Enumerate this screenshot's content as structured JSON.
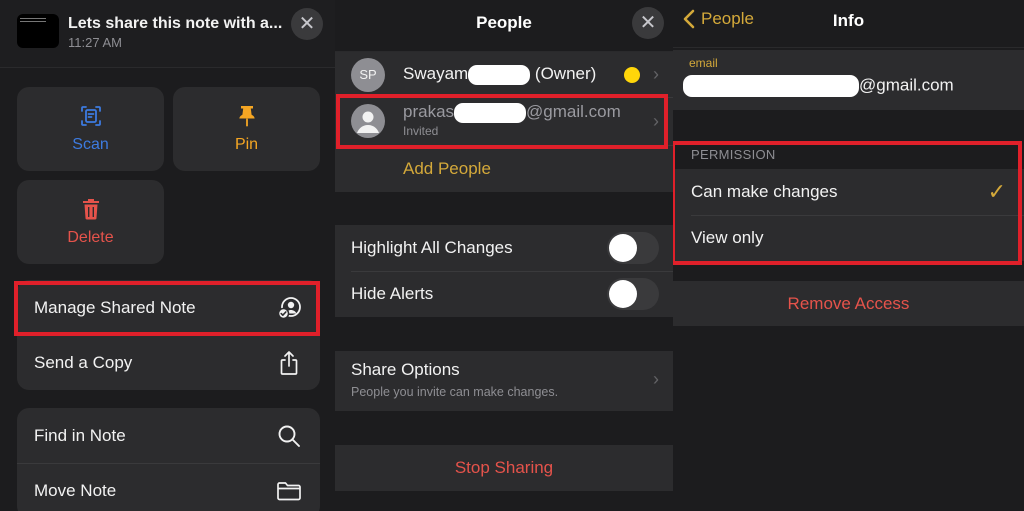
{
  "colors": {
    "background": "#1c1c1e",
    "cell": "#2c2c2e",
    "accent_gold": "#d4a93a",
    "scan_blue": "#3d7be0",
    "pin_orange": "#f5a623",
    "destructive_red": "#e5534b",
    "highlight_box": "#e0202a"
  },
  "share_sheet": {
    "note_title": "Lets share this note with a...",
    "note_time": "11:27 AM",
    "close_icon": "close-icon",
    "tiles": [
      {
        "label": "Scan",
        "icon": "scan-document-icon"
      },
      {
        "label": "Pin",
        "icon": "pin-icon"
      },
      {
        "label": "Delete",
        "icon": "trash-icon"
      }
    ],
    "group1": [
      {
        "label": "Manage Shared Note",
        "icon": "person-circle-checkmark-icon",
        "highlighted": true
      },
      {
        "label": "Send a Copy",
        "icon": "share-icon"
      }
    ],
    "group2": [
      {
        "label": "Find in Note",
        "icon": "search-icon"
      },
      {
        "label": "Move Note",
        "icon": "folder-icon"
      }
    ]
  },
  "people": {
    "title": "People",
    "close_icon": "close-icon",
    "members": [
      {
        "initials": "SP",
        "name_prefix": "Swayam",
        "name_suffix": "(Owner)",
        "status_dot": "#ffd60a"
      },
      {
        "name_prefix": "prakas",
        "name_suffix": "@gmail.com",
        "subtitle": "Invited",
        "highlighted": true
      }
    ],
    "add_people": "Add People",
    "toggles": [
      {
        "label": "Highlight All Changes",
        "on": false
      },
      {
        "label": "Hide Alerts",
        "on": false
      }
    ],
    "share_options": {
      "label": "Share Options",
      "subtitle": "People you invite can make changes."
    },
    "stop_sharing": "Stop Sharing"
  },
  "info": {
    "back_label": "People",
    "title": "Info",
    "email_label": "email",
    "email_suffix": "@gmail.com",
    "permission_header": "PERMISSION",
    "permissions": [
      {
        "label": "Can make changes",
        "selected": true
      },
      {
        "label": "View only",
        "selected": false
      }
    ],
    "remove_access": "Remove Access"
  }
}
